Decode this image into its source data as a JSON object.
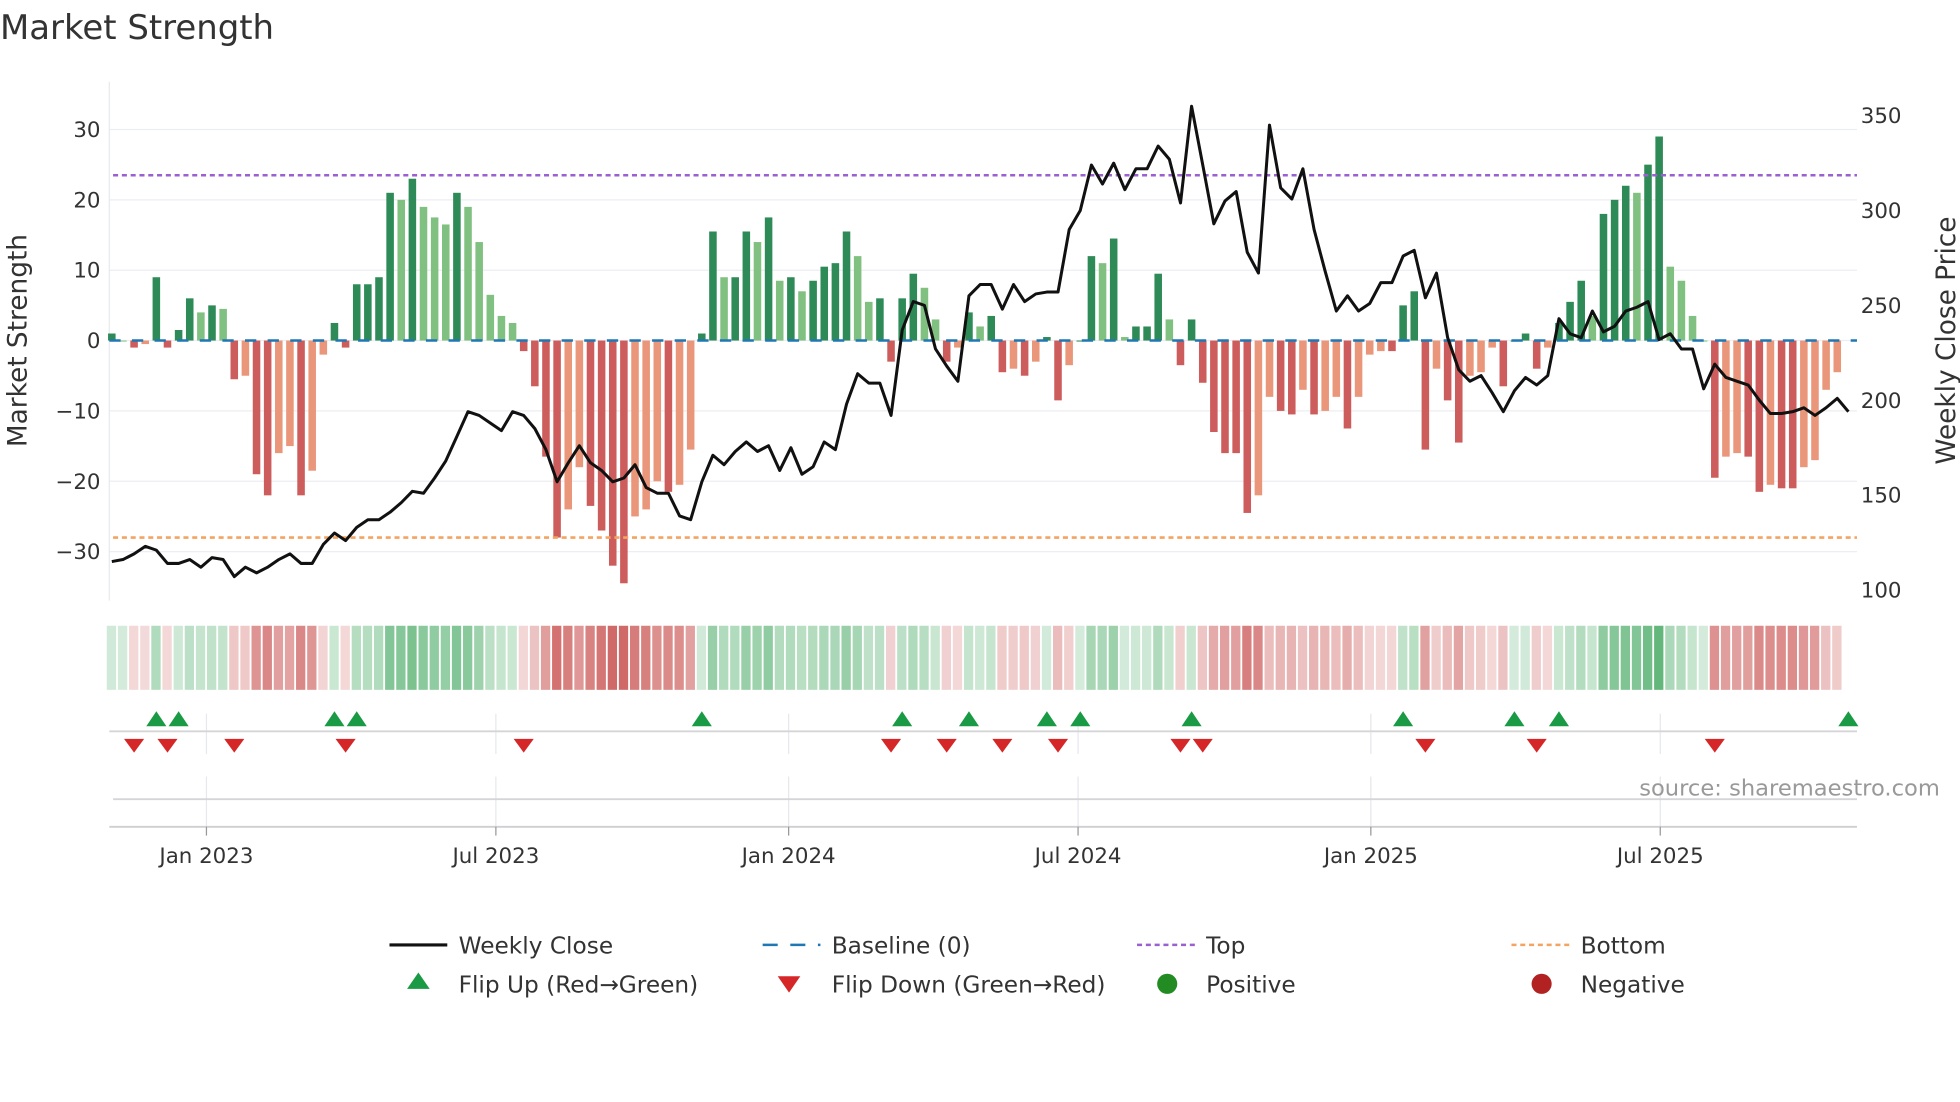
{
  "title": "Market Strength",
  "source": "source: sharemaestro.com",
  "colors": {
    "pos_rising": "#2e8b57",
    "pos_falling": "#80c080",
    "neg_falling": "#cd5c5c",
    "neg_rising": "#e9967a",
    "top": "#9a5fd0",
    "bottom": "#f4a460",
    "baseline": "#1f77b4",
    "flip_up": "#1a9a45",
    "flip_down": "#d62728",
    "positive": "#228b22",
    "negative": "#b22222"
  },
  "chart_data": {
    "type": "bar+line",
    "title": "Market Strength",
    "ylabel": "Market Strength",
    "y2label": "Weekly Close Price",
    "ylim": [
      -37,
      37
    ],
    "y2lim": [
      95,
      362
    ],
    "yticks": [
      "30",
      "20",
      "10",
      "0",
      "−10",
      "−20",
      "−30"
    ],
    "ytick_values": [
      30,
      20,
      10,
      0,
      -10,
      -20,
      -30
    ],
    "y2ticks": [
      350,
      300,
      250,
      200,
      150,
      100
    ],
    "xticks": [
      "Jan 2023",
      "Jul 2023",
      "Jan 2024",
      "Jul 2024",
      "Jan 2025",
      "Jul 2025"
    ],
    "xtick_week_index": [
      8.5,
      34.5,
      60.8,
      86.8,
      113.1,
      139.1
    ],
    "top_level": 23.5,
    "bottom_level": -28,
    "grid": true,
    "legend_position": "bottom",
    "strength": [
      1,
      0,
      -1,
      -0.5,
      9,
      -1,
      1.5,
      6,
      4,
      5,
      4.5,
      -5.5,
      -5,
      -19,
      -22,
      -16,
      -15,
      -22,
      -18.5,
      -2,
      2.5,
      -1,
      8,
      8,
      9,
      21,
      20,
      23,
      19,
      17.5,
      16.5,
      21,
      19,
      14,
      6.5,
      3.5,
      2.5,
      -1.5,
      -6.5,
      -16.5,
      -28,
      -24,
      -18,
      -23.5,
      -27,
      -32,
      -34.5,
      -25,
      -24,
      -20,
      -21.5,
      -20.5,
      -15.5,
      1,
      15.5,
      9,
      9,
      15.5,
      14,
      17.5,
      8.5,
      9,
      7,
      8.5,
      10.5,
      11,
      15.5,
      12,
      5.5,
      6,
      -3,
      6,
      9.5,
      7.5,
      3,
      -3,
      -1,
      4,
      2,
      3.5,
      -4.5,
      -4,
      -5,
      -3,
      0.5,
      -8.5,
      -3.5,
      0,
      12,
      11,
      14.5,
      0.5,
      2,
      2,
      9.5,
      3,
      -3.5,
      3,
      -6,
      -13,
      -16,
      -16,
      -24.5,
      -22,
      -8,
      -10,
      -10.5,
      -7,
      -10.5,
      -10,
      -8,
      -12.5,
      -8,
      -2,
      -1.5,
      -1.5,
      5,
      7,
      -15.5,
      -4,
      -8.5,
      -14.5,
      -5,
      -4.5,
      -1,
      -6.5,
      0,
      1,
      -4,
      -1,
      2.5,
      5.5,
      8.5,
      3.5,
      18,
      20,
      22,
      21,
      25,
      29,
      10.5,
      8.5,
      3.5,
      0,
      -19.5,
      -16.5,
      -16,
      -16.5,
      -21.5,
      -20.5,
      -21,
      -21,
      -18,
      -17,
      -7,
      -4.5
    ],
    "weekly_close": [
      115,
      116,
      119,
      123,
      121,
      114,
      114,
      116,
      112,
      117,
      116,
      107,
      112,
      109,
      112,
      116,
      119,
      114,
      114,
      124,
      130,
      126,
      133,
      137,
      137,
      141,
      146,
      152,
      151,
      159,
      168,
      181,
      194,
      192,
      188,
      184,
      194,
      192,
      185,
      174,
      157,
      167,
      176,
      167,
      163,
      157,
      159,
      166,
      154,
      151,
      151,
      139,
      137,
      157,
      171,
      166,
      173,
      178,
      173,
      176,
      163,
      175,
      161,
      165,
      178,
      174,
      198,
      214,
      209,
      209,
      192,
      237,
      252,
      250,
      227,
      218,
      210,
      255,
      261,
      261,
      248,
      261,
      252,
      256,
      257,
      257,
      290,
      300,
      324,
      314,
      325,
      311,
      322,
      322,
      334,
      327,
      304,
      355,
      324,
      293,
      305,
      310,
      278,
      267,
      345,
      312,
      306,
      322,
      290,
      268,
      247,
      255,
      247,
      251,
      262,
      262,
      276,
      279,
      254,
      267,
      233,
      216,
      210,
      213,
      204,
      194,
      205,
      212,
      208,
      213,
      243,
      235,
      233,
      247,
      236,
      239,
      247,
      249,
      252,
      232,
      235,
      227,
      227,
      206,
      219,
      212,
      210,
      208,
      200,
      193,
      193,
      194,
      196,
      192,
      196,
      201,
      194
    ],
    "flip_up_week_index": [
      4,
      6,
      20,
      22,
      53,
      71,
      77,
      84,
      87,
      97,
      116,
      126,
      130,
      156
    ],
    "flip_down_week_index": [
      2,
      5,
      11,
      21,
      37,
      70,
      75,
      80,
      85,
      96,
      98,
      118,
      128,
      144
    ]
  },
  "legend": [
    {
      "label": "Weekly Close",
      "kind": "line"
    },
    {
      "label": "Baseline (0)",
      "kind": "dash"
    },
    {
      "label": "Top",
      "kind": "dot-top"
    },
    {
      "label": "Bottom",
      "kind": "dot-bottom"
    },
    {
      "label": "Flip Up (Red→Green)",
      "kind": "tri-up"
    },
    {
      "label": "Flip Down (Green→Red)",
      "kind": "tri-down"
    },
    {
      "label": "Positive",
      "kind": "circle-pos"
    },
    {
      "label": "Negative",
      "kind": "circle-neg"
    }
  ]
}
